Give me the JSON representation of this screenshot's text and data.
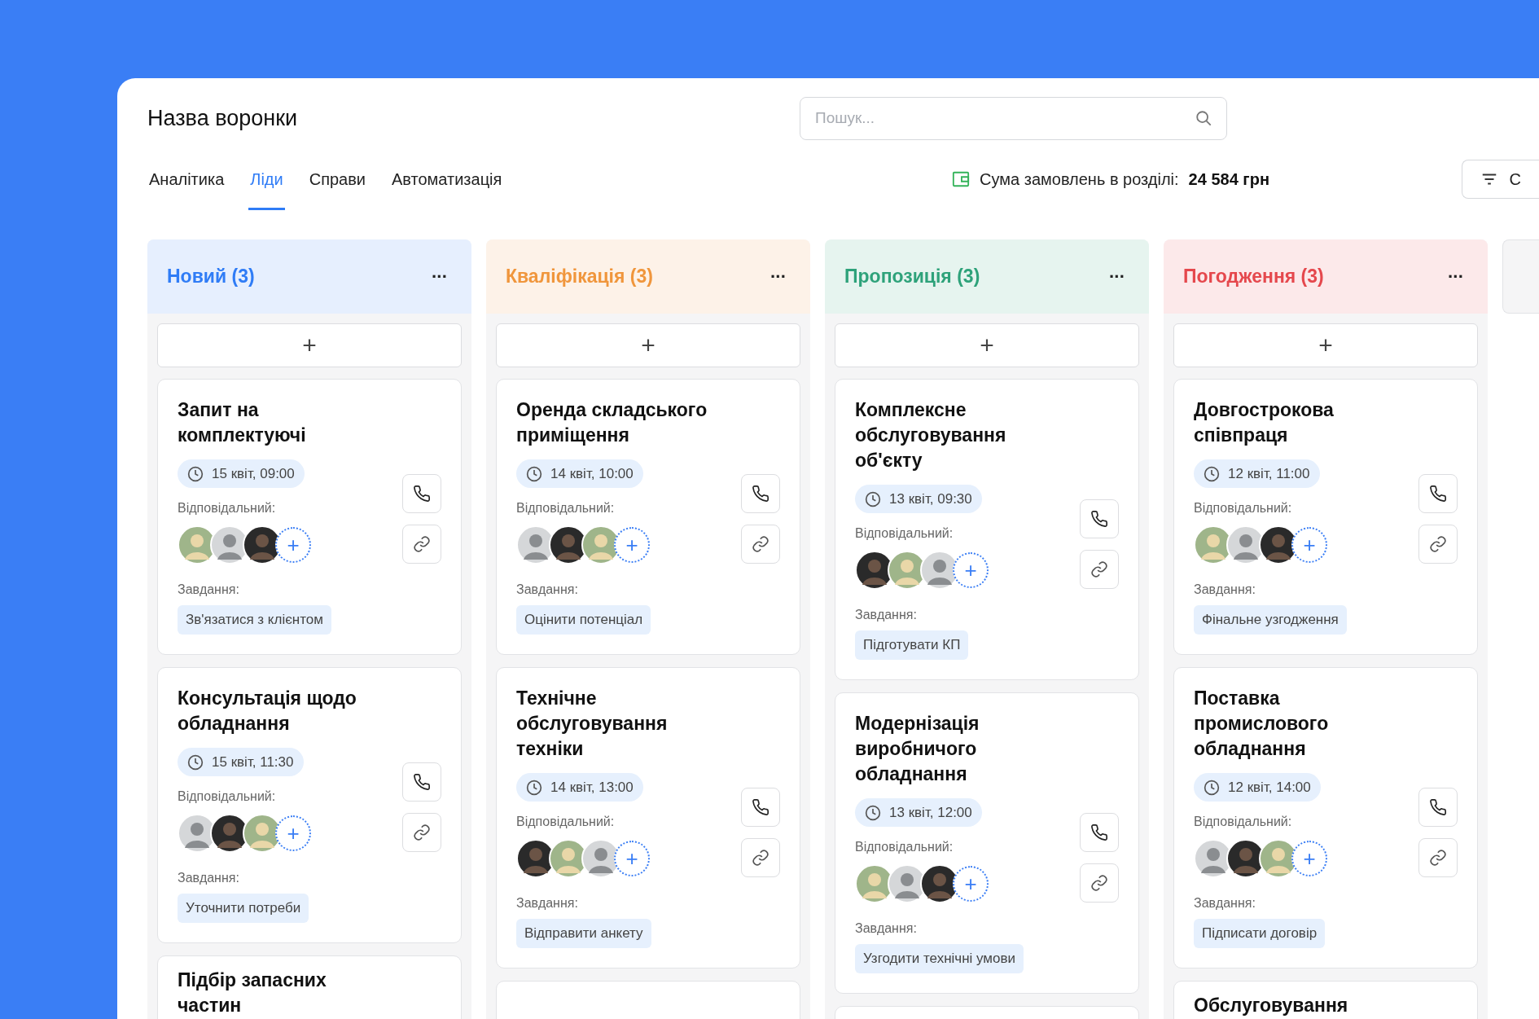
{
  "title": "Назва воронки",
  "search": {
    "placeholder": "Пошук..."
  },
  "tabs": [
    {
      "label": "Аналітика",
      "selected": false
    },
    {
      "label": "Ліди",
      "selected": true
    },
    {
      "label": "Справи",
      "selected": false
    },
    {
      "label": "Автоматизація",
      "selected": false
    }
  ],
  "summary": {
    "label": "Сума замовлень в розділі:",
    "value": "24 584 грн"
  },
  "filter_button": {
    "label": "С"
  },
  "columns": [
    {
      "kind": "stage",
      "title": "Новий (3)",
      "color": "#2f7cf6",
      "more": "···",
      "add": "+",
      "cards": [
        {
          "kind": "full",
          "title": "Запит на комплектуючі",
          "date": "15 квіт, 09:00",
          "responsible_label": "Відповідальний:",
          "add_avatar": "+",
          "tasks_label": "Завдання:",
          "task": "Зв'язатися з клієнтом"
        },
        {
          "kind": "full",
          "title": "Консультація щодо обладнання",
          "date": "15 квіт, 11:30",
          "responsible_label": "Відповідальний:",
          "add_avatar": "+",
          "tasks_label": "Завдання:",
          "task": "Уточнити потреби"
        },
        {
          "kind": "partial",
          "title": "Підбір запасних частин"
        }
      ]
    },
    {
      "kind": "stage",
      "title": "Кваліфікація (3)",
      "color": "#f0963c",
      "more": "···",
      "add": "+",
      "cards": [
        {
          "kind": "full",
          "title": "Оренда складського приміщення",
          "date": "14 квіт, 10:00",
          "responsible_label": "Відповідальний:",
          "add_avatar": "+",
          "tasks_label": "Завдання:",
          "task": "Оцінити потенціал"
        },
        {
          "kind": "full",
          "title": "Технічне обслуговування техніки",
          "date": "14 квіт, 13:00",
          "responsible_label": "Відповідальний:",
          "add_avatar": "+",
          "tasks_label": "Завдання:",
          "task": "Відправити анкету"
        },
        {
          "kind": "partial"
        }
      ]
    },
    {
      "kind": "stage",
      "title": "Пропозиція (3)",
      "color": "#2ea27a",
      "more": "···",
      "add": "+",
      "cards": [
        {
          "kind": "full",
          "title": "Комплексне обслуговування об'єкту",
          "date": "13 квіт, 09:30",
          "responsible_label": "Відповідальний:",
          "add_avatar": "+",
          "tasks_label": "Завдання:",
          "task": "Підготувати КП"
        },
        {
          "kind": "full",
          "title": "Модернізація виробничого обладнання",
          "date": "13 квіт, 12:00",
          "responsible_label": "Відповідальний:",
          "add_avatar": "+",
          "tasks_label": "Завдання:",
          "task": "Узгодити технічні умови"
        },
        {
          "kind": "partial"
        }
      ]
    },
    {
      "kind": "stage",
      "title": "Погодження (3)",
      "color": "#e5484d",
      "more": "···",
      "add": "+",
      "cards": [
        {
          "kind": "full",
          "title": "Довгострокова співпраця",
          "date": "12 квіт, 11:00",
          "responsible_label": "Відповідальний:",
          "add_avatar": "+",
          "tasks_label": "Завдання:",
          "task": "Фінальне узгодження"
        },
        {
          "kind": "full",
          "title": "Поставка промислового обладнання",
          "date": "12 квіт, 14:00",
          "responsible_label": "Відповідальний:",
          "add_avatar": "+",
          "tasks_label": "Завдання:",
          "task": "Підписати договір"
        },
        {
          "kind": "partial",
          "title": "Обслуговування"
        }
      ]
    },
    {
      "kind": "stub"
    }
  ]
}
